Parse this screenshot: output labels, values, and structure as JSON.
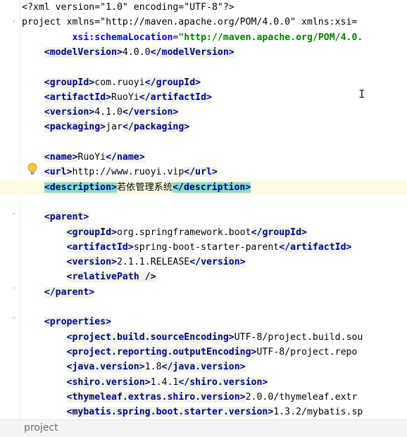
{
  "editor": {
    "lines": [
      "<?xml version=\"1.0\" encoding=\"UTF-8\"?>",
      "<project xmlns=\"http://maven.apache.org/POM/4.0.0\" xmlns:xsi=",
      "         xsi:schemaLocation=\"http://maven.apache.org/POM/4.0.",
      "    <modelVersion>4.0.0</modelVersion>",
      "",
      "    <groupId>com.ruoyi</groupId>",
      "    <artifactId>RuoYi</artifactId>",
      "    <version>4.1.0</version>",
      "    <packaging>jar</packaging>",
      "",
      "    <name>RuoYi</name>",
      "    <url>http://www.ruoyi.vip</url>",
      "    <description>若依管理系统</description>",
      "",
      "    <parent>",
      "        <groupId>org.springframework.boot</groupId>",
      "        <artifactId>spring-boot-starter-parent</artifactId>",
      "        <version>2.1.1.RELEASE</version>",
      "        <relativePath />",
      "    </parent>",
      "",
      "    <properties>",
      "        <project.build.sourceEncoding>UTF-8</project.build.sou",
      "        <project.reporting.outputEncoding>UTF-8</project.repo",
      "        <java.version>1.8</java.version>",
      "        <shiro.version>1.4.1</shiro.version>",
      "        <thymeleaf.extras.shiro.version>2.0.0</thymeleaf.extr",
      "        <mybatis.spring.boot.starter.version>1.3.2</mybatis.sp"
    ]
  },
  "highlighted_line": 12,
  "icons": {
    "intention": "lightbulb-icon",
    "caret": "text-cursor-icon"
  },
  "breadcrumb": {
    "label": "project"
  }
}
